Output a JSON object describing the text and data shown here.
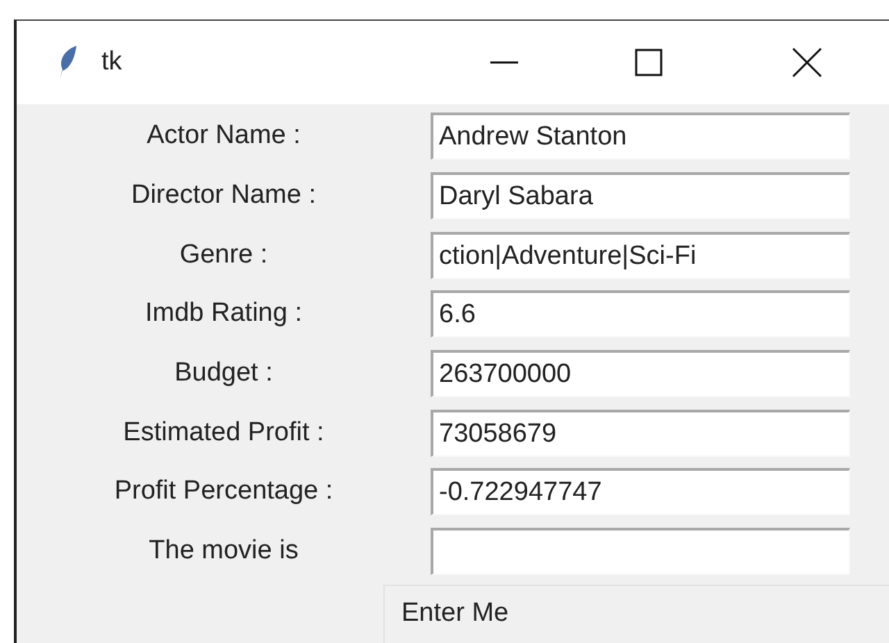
{
  "window": {
    "title": "tk"
  },
  "fields": [
    {
      "label": "Actor Name :",
      "value": "Andrew Stanton"
    },
    {
      "label": "Director Name :",
      "value": "Daryl Sabara"
    },
    {
      "label": "Genre :",
      "value": "ction|Adventure|Sci-Fi"
    },
    {
      "label": "Imdb Rating :",
      "value": "6.6"
    },
    {
      "label": "Budget :",
      "value": "263700000"
    },
    {
      "label": "Estimated Profit :",
      "value": "73058679"
    },
    {
      "label": "Profit Percentage :",
      "value": "-0.722947747"
    },
    {
      "label": "The movie is"
    }
  ],
  "button": {
    "label": "Enter Me"
  }
}
